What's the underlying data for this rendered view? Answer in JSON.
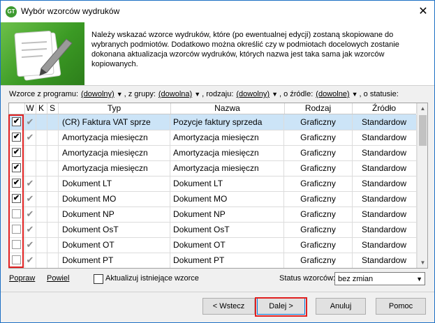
{
  "window": {
    "title": "Wybór wzorców wydruków",
    "logo_text": "GT"
  },
  "banner": {
    "text": "Należy wskazać wzorce wydruków, które (po ewentualnej edycji) zostaną skopiowane do wybranych podmiotów. Dodatkowo można określić czy w podmiotach docelowych zostanie dokonana aktualizacja wzorców wydruków, których nazwa jest taka sama jak wzorców kopiowanych."
  },
  "filters": {
    "program_label": "Wzorce z programu:",
    "program_value": "(dowolny)",
    "group_label": ", z grupy:",
    "group_value": "(dowolna)",
    "kind_label": ", rodzaju:",
    "kind_value": "(dowolny)",
    "source_label": ", o źródle:",
    "source_value": "(dowolne)",
    "status_label": ", o statusie:"
  },
  "grid": {
    "columns": [
      "",
      "W",
      "K",
      "S",
      "Typ",
      "Nazwa",
      "Rodzaj",
      "Źródło"
    ],
    "rows": [
      {
        "checked": true,
        "w": true,
        "typ": "(CR) Faktura VAT sprze",
        "nazwa": "Pozycje faktury sprzeda",
        "rodzaj": "Graficzny",
        "zrodlo": "Standardow",
        "selected": true
      },
      {
        "checked": true,
        "w": true,
        "typ": "Amortyzacja miesięczn",
        "nazwa": "Amortyzacja miesięczn",
        "rodzaj": "Graficzny",
        "zrodlo": "Standardow",
        "selected": false
      },
      {
        "checked": true,
        "w": false,
        "typ": "Amortyzacja miesięczn",
        "nazwa": "Amortyzacja miesięczn",
        "rodzaj": "Graficzny",
        "zrodlo": "Standardow",
        "selected": false
      },
      {
        "checked": true,
        "w": false,
        "typ": "Amortyzacja miesięczn",
        "nazwa": "Amortyzacja miesięczn",
        "rodzaj": "Graficzny",
        "zrodlo": "Standardow",
        "selected": false
      },
      {
        "checked": true,
        "w": true,
        "typ": "Dokument LT",
        "nazwa": "Dokument LT",
        "rodzaj": "Graficzny",
        "zrodlo": "Standardow",
        "selected": false
      },
      {
        "checked": true,
        "w": true,
        "typ": "Dokument MO",
        "nazwa": "Dokument MO",
        "rodzaj": "Graficzny",
        "zrodlo": "Standardow",
        "selected": false
      },
      {
        "checked": false,
        "w": true,
        "typ": "Dokument NP",
        "nazwa": "Dokument NP",
        "rodzaj": "Graficzny",
        "zrodlo": "Standardow",
        "selected": false
      },
      {
        "checked": false,
        "w": true,
        "typ": "Dokument OsT",
        "nazwa": "Dokument OsT",
        "rodzaj": "Graficzny",
        "zrodlo": "Standardow",
        "selected": false
      },
      {
        "checked": false,
        "w": true,
        "typ": "Dokument OT",
        "nazwa": "Dokument OT",
        "rodzaj": "Graficzny",
        "zrodlo": "Standardow",
        "selected": false
      },
      {
        "checked": false,
        "w": true,
        "typ": "Dokument PT",
        "nazwa": "Dokument PT",
        "rodzaj": "Graficzny",
        "zrodlo": "Standardow",
        "selected": false
      }
    ]
  },
  "bottom": {
    "popraw": "Popraw",
    "powiel": "Powiel",
    "update_label": "Aktualizuj istniejące wzorce",
    "status_label": "Status wzorców:",
    "status_value": "bez zmian"
  },
  "buttons": {
    "back": "< Wstecz",
    "next": "Dalej >",
    "cancel": "Anuluj",
    "help": "Pomoc"
  },
  "colors": {
    "selected_row": "#cce4f7",
    "highlight": "#e02020",
    "banner_green": "#3b9a24"
  }
}
